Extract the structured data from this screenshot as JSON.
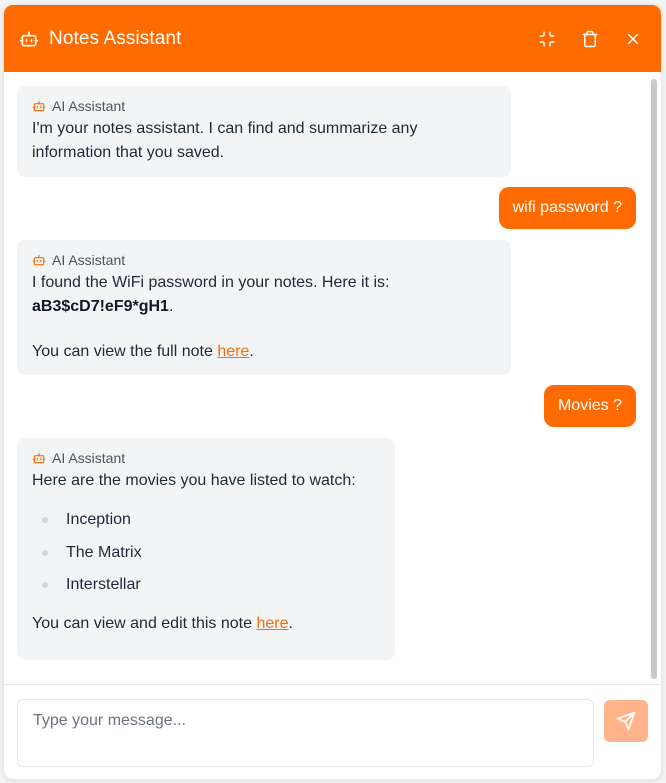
{
  "header": {
    "title": "Notes Assistant",
    "icons": [
      "bot-icon",
      "minimize-icon",
      "trash-icon",
      "close-icon"
    ],
    "background": "#ff6b00"
  },
  "messages": [
    {
      "role": "assistant",
      "label": "AI Assistant",
      "text": "I'm your notes assistant. I can find and summarize any information that you saved."
    },
    {
      "role": "user",
      "text": "wifi password ?"
    },
    {
      "role": "assistant",
      "label": "AI Assistant",
      "text_before": "I found the WiFi password in your notes. Here it is: ",
      "password": "aB3$cD7!eF9*gH1",
      "text_after": ".",
      "link_prefix": "You can view the full note ",
      "link_text": "here",
      "link_suffix": "."
    },
    {
      "role": "user",
      "text": "Movies ?"
    },
    {
      "role": "assistant",
      "label": "AI Assistant",
      "intro": "Here are the movies you have listed to watch:",
      "items": [
        "Inception",
        "The Matrix",
        "Interstellar"
      ],
      "link_prefix": "You can view and edit this note ",
      "link_text": "here",
      "link_suffix": "."
    }
  ],
  "composer": {
    "placeholder": "Type your message...",
    "send_icon": "send-icon",
    "send_color": "#ffb48a"
  }
}
